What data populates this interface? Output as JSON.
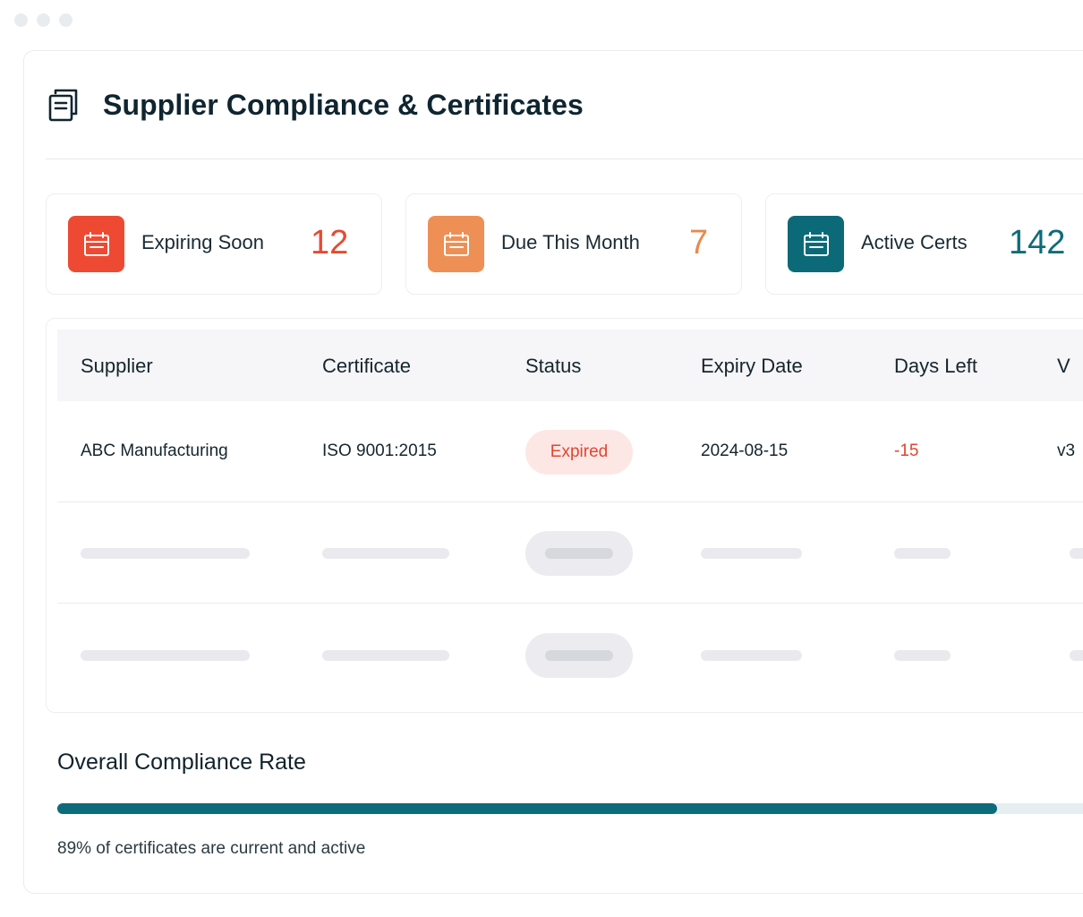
{
  "header": {
    "title": "Supplier Compliance & Certificates",
    "icon": "document-stack-icon"
  },
  "stats": [
    {
      "label": "Expiring Soon",
      "value": "12",
      "color": "#e64a33",
      "badge_color": "#ee4a33",
      "icon": "calendar-icon"
    },
    {
      "label": "Due This Month",
      "value": "7",
      "color": "#e88a4f",
      "badge_color": "#ee8f55",
      "icon": "calendar-icon"
    },
    {
      "label": "Active Certs",
      "value": "142",
      "color": "#0e6b7b",
      "badge_color": "#0c6a78",
      "icon": "calendar-icon"
    }
  ],
  "table": {
    "columns": [
      "Supplier",
      "Certificate",
      "Status",
      "Expiry Date",
      "Days Left",
      "V"
    ],
    "rows": [
      {
        "supplier": "ABC Manufacturing",
        "certificate": "ISO 9001:2015",
        "status": "Expired",
        "expiry": "2024-08-15",
        "days_left": "-15",
        "version": "v3"
      }
    ]
  },
  "compliance": {
    "title": "Overall Compliance Rate",
    "percent": 89,
    "note": "89% of certificates are current and active"
  }
}
